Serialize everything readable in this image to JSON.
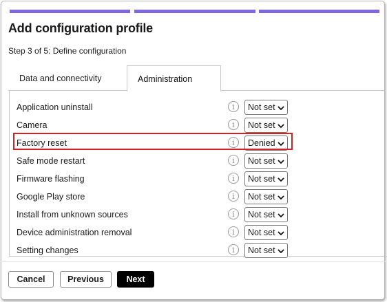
{
  "dialog": {
    "title": "Add configuration profile",
    "step_text": "Step 3 of 5: Define configuration",
    "progress": {
      "current_step": 3,
      "total_steps": 5,
      "accent": "#8067dc"
    }
  },
  "tabs": [
    {
      "label": "Data and connectivity",
      "selected": false
    },
    {
      "label": "Administration",
      "selected": true
    }
  ],
  "settings": [
    {
      "label": "Application uninstall",
      "value": "Not set"
    },
    {
      "label": "Camera",
      "value": "Not set"
    },
    {
      "label": "Factory reset",
      "value": "Denied",
      "highlighted": true
    },
    {
      "label": "Safe mode restart",
      "value": "Not set"
    },
    {
      "label": "Firmware flashing",
      "value": "Not set"
    },
    {
      "label": "Google Play store",
      "value": "Not set"
    },
    {
      "label": "Install from unknown sources",
      "value": "Not set"
    },
    {
      "label": "Device administration removal",
      "value": "Not set"
    },
    {
      "label": "Setting changes",
      "value": "Not set"
    }
  ],
  "info_glyph": "i",
  "icons": {
    "info": "info-circle-icon",
    "dropdown": "chevron-down-icon"
  },
  "highlight_color": "#d61f1f",
  "buttons": {
    "cancel": "Cancel",
    "previous": "Previous",
    "next": "Next"
  }
}
